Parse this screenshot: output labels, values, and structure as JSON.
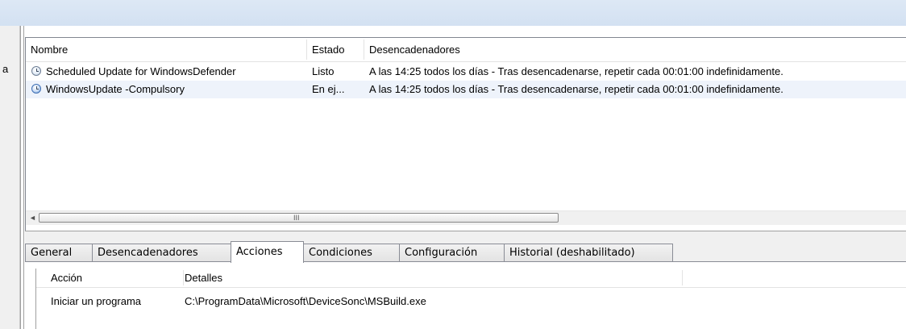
{
  "left_frame": {
    "cut_letter": "a"
  },
  "task_list": {
    "columns": [
      "Nombre",
      "Estado",
      "Desencadenadores"
    ],
    "rows": [
      {
        "name": "Scheduled Update for WindowsDefender",
        "status": "Listo",
        "triggers": "A las 14:25 todos los días - Tras desencadenarse, repetir cada 00:01:00 indefinidamente.",
        "icon": "clock-icon",
        "selected": false
      },
      {
        "name": "WindowsUpdate -Compulsory",
        "status": "En ej...",
        "triggers": "A las 14:25 todos los días - Tras desencadenarse, repetir cada 00:01:00 indefinidamente.",
        "icon": "clock-running-icon",
        "selected": true
      }
    ],
    "scrollbar": {
      "left_arrow": "◄",
      "grip": "III"
    }
  },
  "tabs": [
    {
      "label": "General",
      "active": false
    },
    {
      "label": "Desencadenadores",
      "active": false
    },
    {
      "label": "Acciones",
      "active": true
    },
    {
      "label": "Condiciones",
      "active": false
    },
    {
      "label": "Configuración",
      "active": false
    },
    {
      "label": "Historial (deshabilitado)",
      "active": false
    }
  ],
  "actions_list": {
    "columns": [
      "Acción",
      "Detalles"
    ],
    "rows": [
      {
        "action": "Iniciar un programa",
        "details": "C:\\ProgramData\\Microsoft\\DeviceSonc\\MSBuild.exe"
      }
    ]
  },
  "colors": {
    "title_bar": "#d6e3f3",
    "selected_row": "#eef3fb",
    "border": "#828790"
  }
}
